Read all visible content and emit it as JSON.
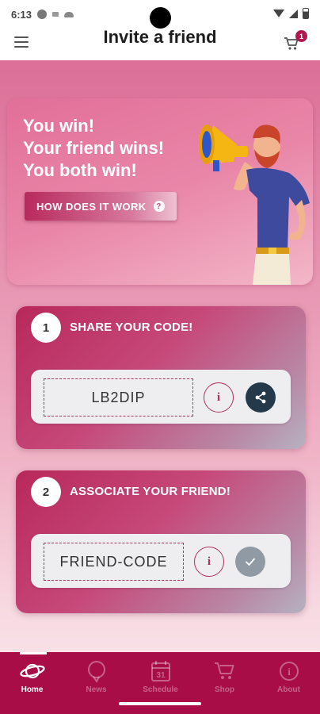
{
  "status_bar": {
    "time": "6:13"
  },
  "app_bar": {
    "title": "Invite a friend",
    "cart_badge": "1"
  },
  "hero": {
    "line1": "You win!",
    "line2": "Your friend wins!",
    "line3": "You both win!",
    "how_button": "HOW DOES IT WORK",
    "how_icon": "?"
  },
  "steps": [
    {
      "number": "1",
      "title": "SHARE YOUR CODE!",
      "code": "LB2DIP",
      "info_icon": "i"
    },
    {
      "number": "2",
      "title": "ASSOCIATE YOUR FRIEND!",
      "code": "FRIEND-CODE",
      "info_icon": "i"
    }
  ],
  "bottom_nav": {
    "items": [
      {
        "label": "Home",
        "icon": "planet-icon",
        "active": true
      },
      {
        "label": "News",
        "icon": "news-bubble-icon",
        "active": false
      },
      {
        "label": "Schedule",
        "icon": "calendar-icon",
        "active": false,
        "icon_text": "31"
      },
      {
        "label": "Shop",
        "icon": "cart-icon",
        "active": false
      },
      {
        "label": "About",
        "icon": "info-icon",
        "active": false,
        "icon_text": "i"
      }
    ]
  },
  "colors": {
    "brand": "#a80d48",
    "accent_dark": "#243a4b",
    "dashed_border": "#b0305e"
  }
}
